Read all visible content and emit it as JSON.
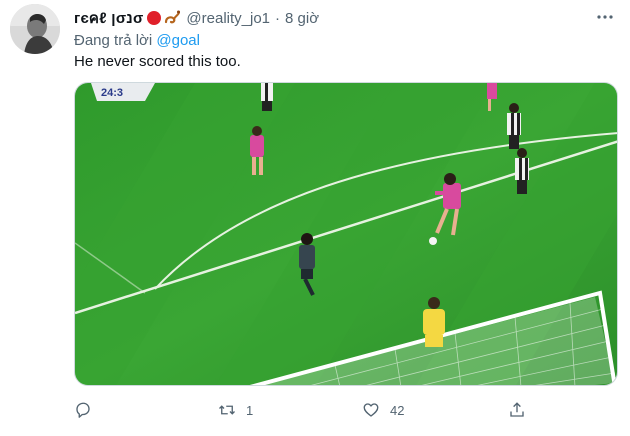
{
  "tweet": {
    "display_name": "гєคℓ ןσנσ",
    "handle": "@reality_jo1",
    "separator": "·",
    "time": "8 giờ",
    "reply_label": "Đang trả lời",
    "reply_mention": "@goal",
    "text": "He never scored this too.",
    "media": {
      "scoreboard_fragment": "24:3"
    }
  },
  "actions": {
    "reply_count": "",
    "retweet_count": "1",
    "like_count": "42"
  },
  "icons": [
    "more-icon",
    "reply-icon",
    "retweet-icon",
    "like-icon",
    "share-icon"
  ],
  "colors": {
    "link": "#1d9bf0",
    "muted": "#536471",
    "pitch": "#2f9a2c"
  }
}
